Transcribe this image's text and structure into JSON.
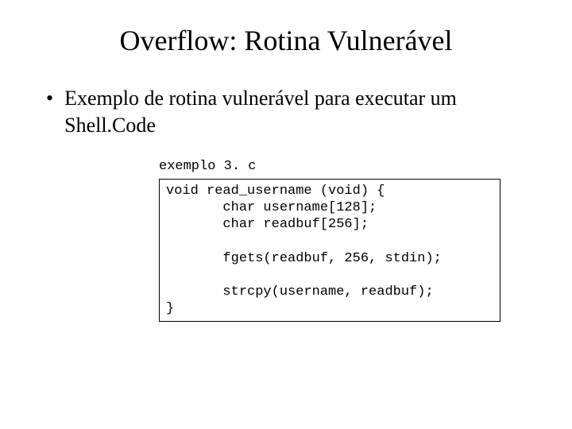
{
  "title": "Overflow: Rotina Vulnerável",
  "bullet": {
    "dot": "•",
    "text": "Exemplo de rotina vulnerável para executar um Shell.Code"
  },
  "filename": "exemplo 3. c",
  "code": "void read_username (void) {\n       char username[128];\n       char readbuf[256];\n\n       fgets(readbuf, 256, stdin);\n\n       strcpy(username, readbuf);\n}"
}
